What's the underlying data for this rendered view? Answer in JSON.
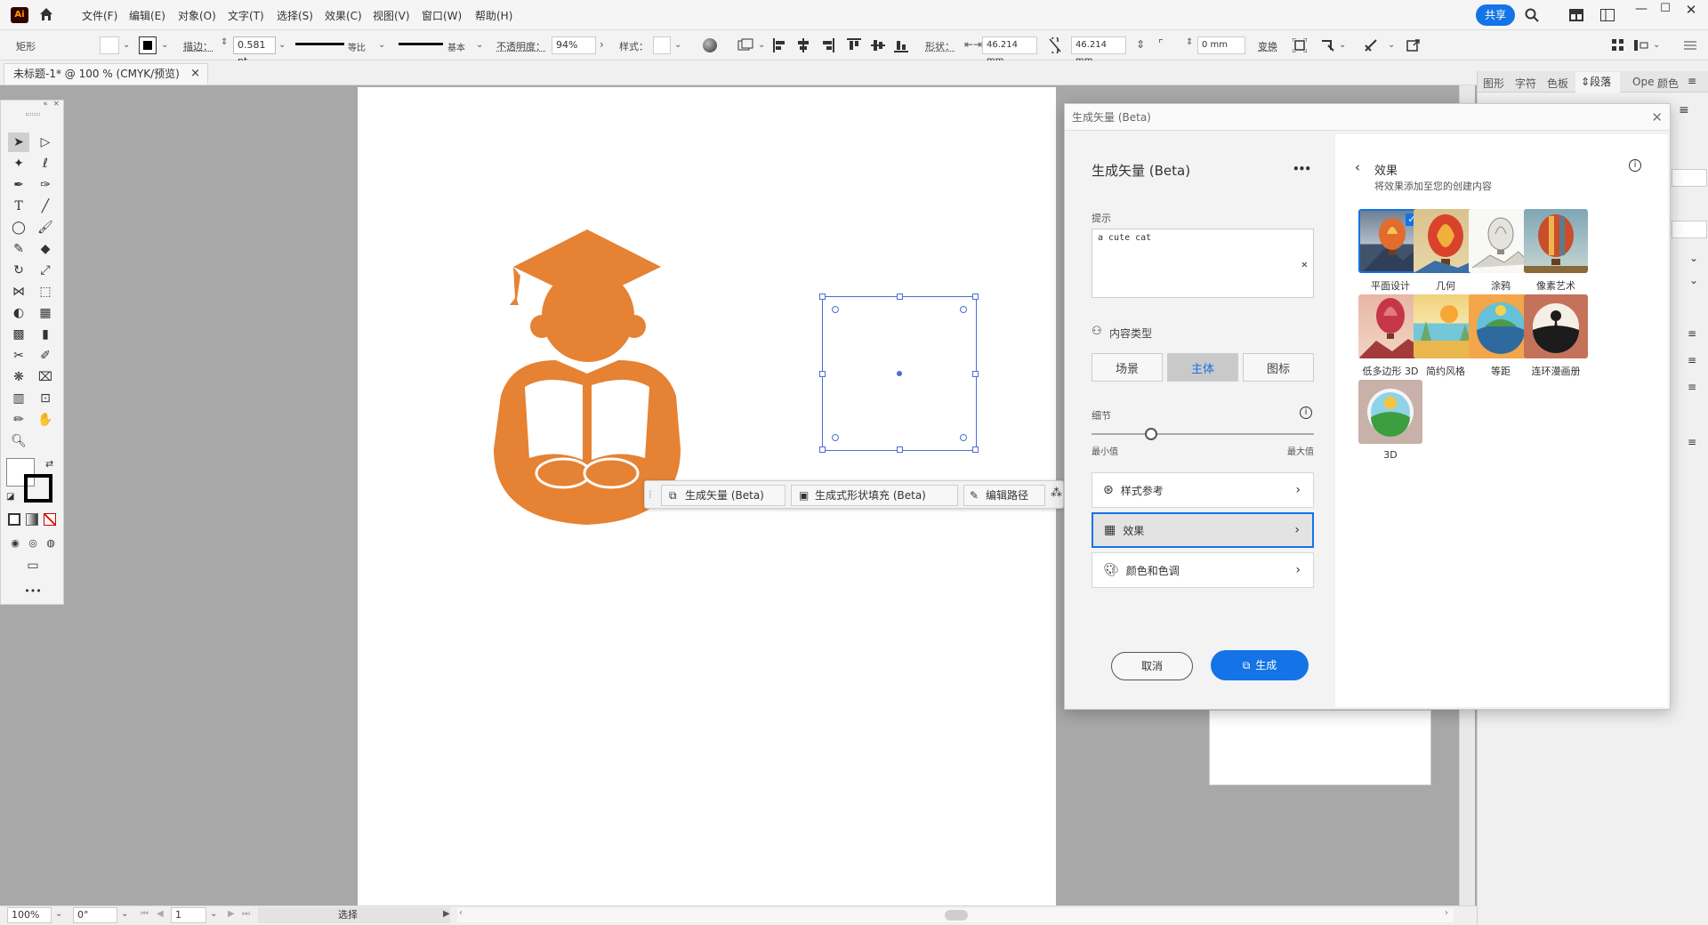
{
  "app": {
    "logo": "Ai",
    "share_label": "共享"
  },
  "menu": [
    "文件(F)",
    "编辑(E)",
    "对象(O)",
    "文字(T)",
    "选择(S)",
    "效果(C)",
    "视图(V)",
    "窗口(W)",
    "帮助(H)"
  ],
  "control": {
    "object_type": "矩形",
    "stroke_label": "描边：",
    "stroke_value": "0.581 pt",
    "profile_label": "等比",
    "brush_label": "基本",
    "opacity_label": "不透明度：",
    "opacity_value": "94%",
    "style_label": "样式：",
    "shape_label": "形状：",
    "width_value": "46.214 mm",
    "height_value": "46.214 mm",
    "corner_value": "0 mm",
    "transform_label": "变换"
  },
  "doc_tab": {
    "title": "未标题-1* @ 100 % (CMYK/预览)",
    "close": "×"
  },
  "context_bar": {
    "gen_vector": "生成矢量 (Beta)",
    "gen_fill": "生成式形状填充 (Beta)",
    "edit_path": "编辑路径"
  },
  "status": {
    "zoom": "100%",
    "angle": "0°",
    "page": "1",
    "mode": "选择"
  },
  "right_tabs": [
    "图形",
    "字符",
    "色板",
    "段落",
    "Ope",
    "颜色"
  ],
  "dialog": {
    "window_title": "生成矢量 (Beta)",
    "heading": "生成矢量 (Beta)",
    "more": "•••",
    "prompt_label": "提示",
    "prompt_value": "a cute cat",
    "content_type_label": "内容类型",
    "segments": [
      "场景",
      "主体",
      "图标"
    ],
    "active_segment": "主体",
    "detail_label": "细节",
    "detail_min": "最小值",
    "detail_max": "最大值",
    "detail_level": 0.25,
    "rows": [
      "样式参考",
      "效果",
      "颜色和色调"
    ],
    "cancel": "取消",
    "generate": "生成",
    "effects_title": "效果",
    "effects_subtitle": "将效果添加至您的创建内容",
    "effects": [
      "平面设计",
      "几何",
      "涂鸦",
      "像素艺术",
      "低多边形 3D",
      "简约风格",
      "等距",
      "连环漫画册",
      "3D"
    ],
    "selected_effect": "平面设计"
  },
  "colors": {
    "accent": "#1473e6",
    "figure": "#e58233",
    "selection": "#4a6fd3"
  }
}
